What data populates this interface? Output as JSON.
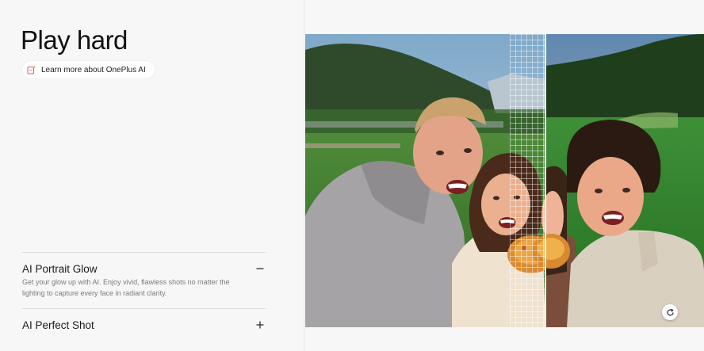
{
  "header": {
    "title": "Play hard",
    "learn_more_label": "Learn more about OnePlus AI"
  },
  "features": [
    {
      "title": "AI Portrait Glow",
      "description": "Get your glow up with AI. Enjoy vivid, flawless shots no matter the lighting to capture every face in radiant clarity.",
      "expanded": true,
      "toggle_icon": "minus-icon"
    },
    {
      "title": "AI Perfect Shot",
      "expanded": false,
      "toggle_icon": "plus-icon"
    }
  ],
  "media": {
    "refresh_icon": "refresh-icon"
  },
  "colors": {
    "background": "#f7f7f7",
    "text": "#1a1a1a",
    "muted_text": "#7a7a7a",
    "divider": "#dcdcdc"
  }
}
